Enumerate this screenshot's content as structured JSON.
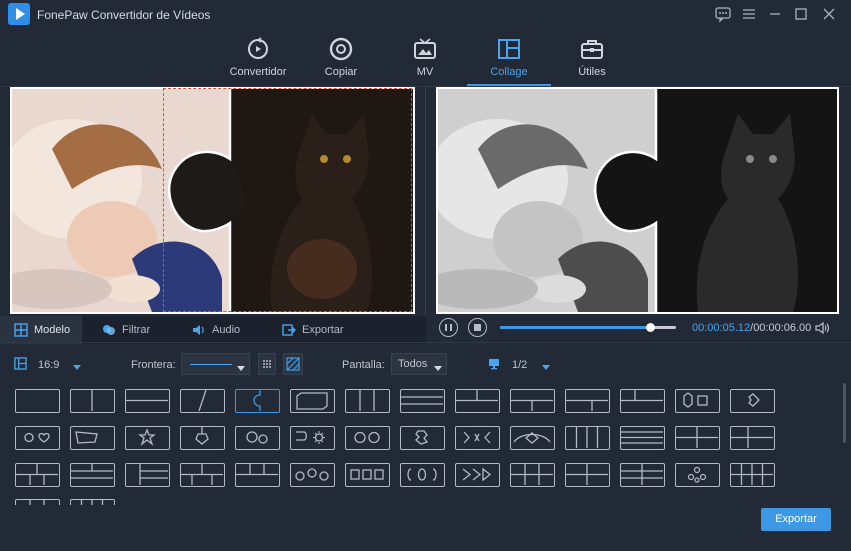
{
  "app": {
    "title": "FonePaw Convertidor de Vídeos"
  },
  "nav": {
    "items": [
      {
        "label": "Convertidor",
        "icon": "convert-icon"
      },
      {
        "label": "Copiar",
        "icon": "disc-icon"
      },
      {
        "label": "MV",
        "icon": "tv-icon"
      },
      {
        "label": "Collage",
        "icon": "collage-icon",
        "active": true
      },
      {
        "label": "Útiles",
        "icon": "toolbox-icon"
      }
    ]
  },
  "tabs": [
    {
      "label": "Modelo",
      "icon": "grid-icon",
      "active": true
    },
    {
      "label": "Filtrar",
      "icon": "filter-icon"
    },
    {
      "label": "Audio",
      "icon": "speaker-icon"
    },
    {
      "label": "Exportar",
      "icon": "export-icon"
    }
  ],
  "player": {
    "current_time": "00:00:05.12",
    "total_time": "00:00:06.00",
    "progress": 0.85
  },
  "toolbar": {
    "aspect": "16:9",
    "border_label": "Frontera:",
    "screen_label": "Pantalla:",
    "screen_value": "Todos",
    "page": "1/2"
  },
  "export_label": "Exportar",
  "colors": {
    "accent": "#3d98e6",
    "background": "#222a37",
    "selection": "#d8513a"
  }
}
